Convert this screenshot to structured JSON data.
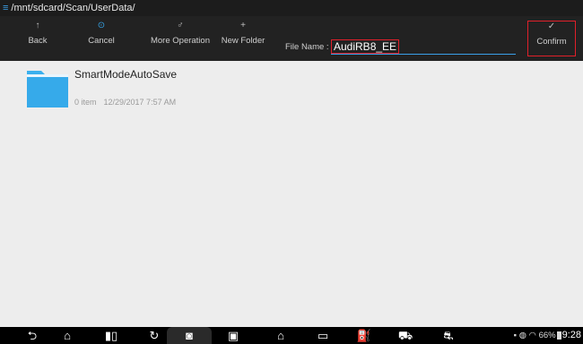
{
  "path": {
    "menu_icon": "menu-icon",
    "text": "/mnt/sdcard/Scan/UserData/"
  },
  "toolbar": {
    "back": {
      "icon": "↑",
      "label": "Back"
    },
    "cancel": {
      "icon": "⊙",
      "label": "Cancel"
    },
    "more": {
      "icon": "♂",
      "label": "More Operation"
    },
    "new_folder": {
      "icon": "+",
      "label": "New Folder"
    },
    "file_name_label": "File Name :",
    "file_name_value": "AudiRB8_EE",
    "confirm": {
      "icon": "✓",
      "label": "Confirm"
    }
  },
  "folder": {
    "name": "SmartModeAutoSave",
    "count": "0 item",
    "date": "12/29/2017 7:57 AM"
  },
  "status": {
    "battery": "66%",
    "time": "9:28"
  },
  "colors": {
    "accent": "#3aa0e8",
    "highlight": "#e0202a",
    "folder": "#3bb0ee"
  }
}
